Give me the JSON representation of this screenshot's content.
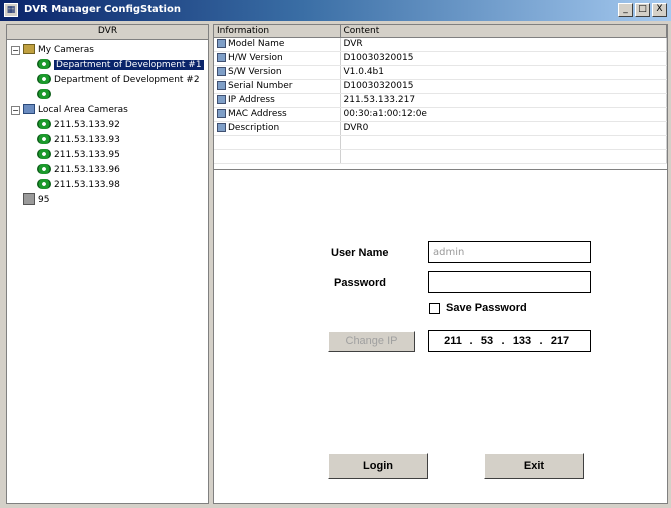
{
  "window": {
    "title": "DVR Manager ConfigStation",
    "buttons": [
      "_",
      "□",
      "X"
    ]
  },
  "tree": {
    "header": "DVR",
    "items": [
      {
        "label": "My Cameras",
        "icon": "folder-icon",
        "expanded": true
      },
      {
        "label": "Department of Development #1",
        "icon": "camera-icon",
        "selected": true
      },
      {
        "label": "Department of Development #2",
        "icon": "camera-icon"
      },
      {
        "label": "",
        "icon": "camera-icon"
      },
      {
        "label": "Local Area Cameras",
        "icon": "network-icon",
        "expanded": true
      },
      {
        "label": "211.53.133.92",
        "icon": "camera-icon"
      },
      {
        "label": "211.53.133.93",
        "icon": "camera-icon"
      },
      {
        "label": "211.53.133.95",
        "icon": "camera-icon"
      },
      {
        "label": "211.53.133.96",
        "icon": "camera-icon"
      },
      {
        "label": "211.53.133.98",
        "icon": "camera-icon"
      },
      {
        "label": "95",
        "icon": "dvr-icon"
      }
    ]
  },
  "info_table": {
    "headers": [
      "Information",
      "Content"
    ],
    "rows": [
      {
        "name": "Model Name",
        "value": "DVR"
      },
      {
        "name": "H/W Version",
        "value": "D10030320015"
      },
      {
        "name": "S/W Version",
        "value": "V1.0.4b1"
      },
      {
        "name": "Serial Number",
        "value": "D10030320015"
      },
      {
        "name": "IP Address",
        "value": "211.53.133.217"
      },
      {
        "name": "MAC Address",
        "value": "00:30:a1:00:12:0e"
      },
      {
        "name": "Description",
        "value": "DVR0"
      }
    ]
  },
  "login": {
    "username_label": "User Name",
    "username_value": "admin",
    "password_label": "Password",
    "password_value": "",
    "save_password_label": "Save Password",
    "change_ip_label": "Change IP",
    "ip": [
      "211",
      "53",
      "133",
      "217"
    ],
    "login_label": "Login",
    "exit_label": "Exit"
  }
}
